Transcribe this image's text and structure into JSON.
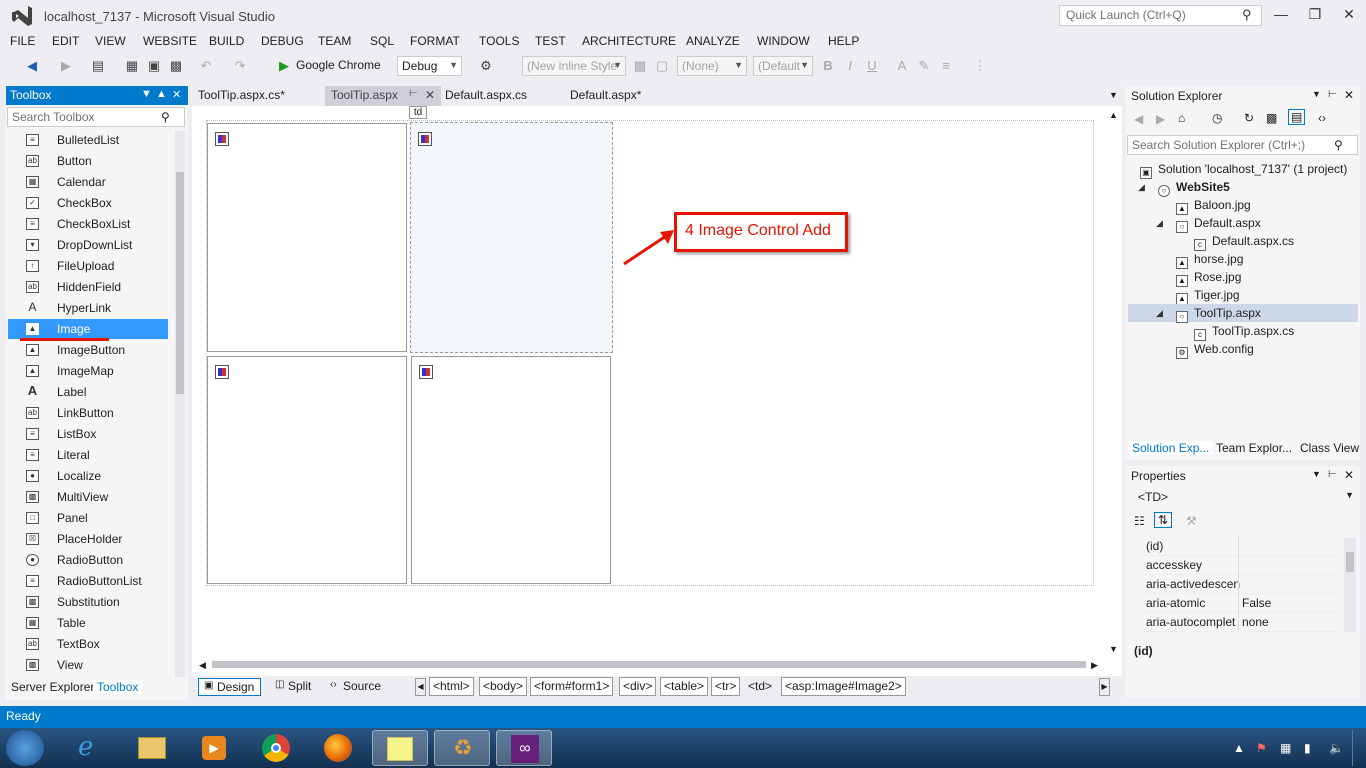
{
  "window": {
    "title": "localhost_7137 - Microsoft Visual Studio",
    "quick_launch_placeholder": "Quick Launch (Ctrl+Q)"
  },
  "menu": [
    "FILE",
    "EDIT",
    "VIEW",
    "WEBSITE",
    "BUILD",
    "DEBUG",
    "TEAM",
    "SQL",
    "FORMAT",
    "TOOLS",
    "TEST",
    "ARCHITECTURE",
    "ANALYZE",
    "WINDOW",
    "HELP"
  ],
  "toolbar": {
    "browser": "Google Chrome",
    "config": "Debug",
    "style": "(New Inline Style",
    "target": "(None)",
    "font": "(Default"
  },
  "toolbox": {
    "title": "Toolbox",
    "search_placeholder": "Search Toolbox",
    "items": [
      "BulletedList",
      "Button",
      "Calendar",
      "CheckBox",
      "CheckBoxList",
      "DropDownList",
      "FileUpload",
      "HiddenField",
      "HyperLink",
      "Image",
      "ImageButton",
      "ImageMap",
      "Label",
      "LinkButton",
      "ListBox",
      "Literal",
      "Localize",
      "MultiView",
      "Panel",
      "PlaceHolder",
      "RadioButton",
      "RadioButtonList",
      "Substitution",
      "Table",
      "TextBox",
      "View"
    ],
    "selected": "Image",
    "bottom_tabs": [
      "Server Explorer",
      "Toolbox"
    ]
  },
  "tabs": [
    "ToolTip.aspx.cs*",
    "ToolTip.aspx",
    "Default.aspx.cs",
    "Default.aspx*"
  ],
  "active_tab": "ToolTip.aspx",
  "designer": {
    "td_tag": "td",
    "callout": "4 Image Control Add"
  },
  "viewbar": {
    "modes": [
      "Design",
      "Split",
      "Source"
    ],
    "breadcrumbs": [
      "<html>",
      "<body>",
      "<form#form1>",
      "<div>",
      "<table>",
      "<tr>",
      "<td>",
      "<asp:Image#Image2>"
    ]
  },
  "solution_explorer": {
    "title": "Solution Explorer",
    "search_placeholder": "Search Solution Explorer (Ctrl+;)",
    "nodes": [
      {
        "label": "Solution 'localhost_7137' (1 project)"
      },
      {
        "label": "WebSite5"
      },
      {
        "label": "Baloon.jpg"
      },
      {
        "label": "Default.aspx"
      },
      {
        "label": "Default.aspx.cs"
      },
      {
        "label": "horse.jpg"
      },
      {
        "label": "Rose.jpg"
      },
      {
        "label": "Tiger.jpg"
      },
      {
        "label": "ToolTip.aspx"
      },
      {
        "label": "ToolTip.aspx.cs"
      },
      {
        "label": "Web.config"
      }
    ],
    "bottom_tabs": [
      "Solution Exp...",
      "Team Explor...",
      "Class View"
    ]
  },
  "properties": {
    "title": "Properties",
    "object": "<TD>",
    "rows": [
      {
        "name": "(id)",
        "value": ""
      },
      {
        "name": "accesskey",
        "value": ""
      },
      {
        "name": "aria-activedescen",
        "value": ""
      },
      {
        "name": "aria-atomic",
        "value": "False"
      },
      {
        "name": "aria-autocomplet",
        "value": "none"
      }
    ],
    "description": "(id)"
  },
  "status": "Ready",
  "colors": {
    "accent": "#007acc",
    "selection": "#3399ff",
    "callout": "#e51400"
  }
}
